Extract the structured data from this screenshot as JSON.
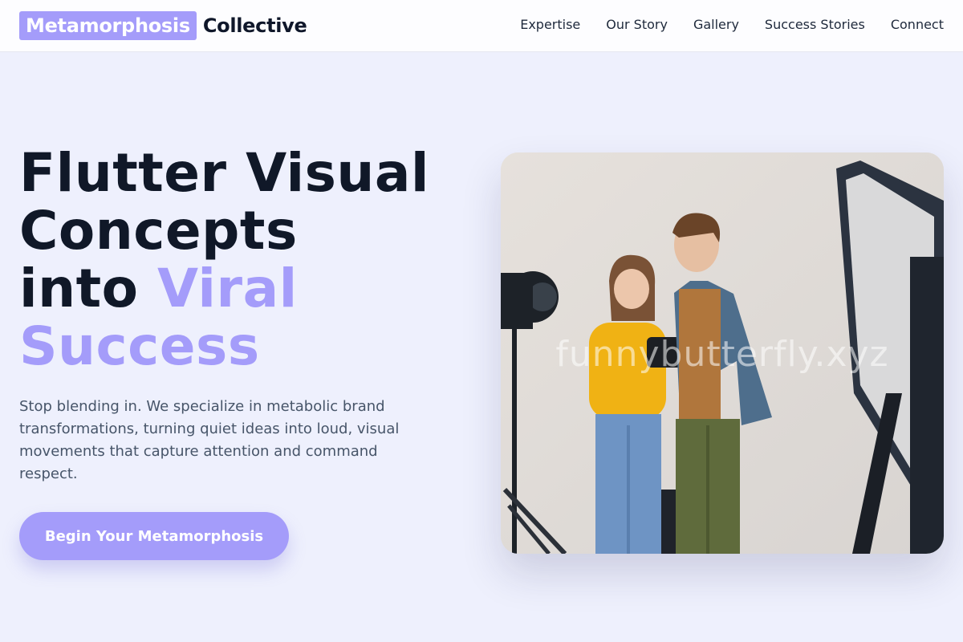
{
  "brand": {
    "highlight": "Metamorphosis",
    "rest": "Collective"
  },
  "nav": [
    {
      "label": "Expertise"
    },
    {
      "label": "Our Story"
    },
    {
      "label": "Gallery"
    },
    {
      "label": "Success Stories"
    },
    {
      "label": "Connect"
    }
  ],
  "hero": {
    "headline_line1": "Flutter Visual",
    "headline_line2": "Concepts",
    "headline_line3_plain": "into ",
    "headline_line3_accent": "Viral",
    "headline_line4_accent": "Success",
    "lede": "Stop blending in. We specialize in metabolic brand transformations, turning quiet ideas into loud, visual movements that capture attention and command respect.",
    "cta_label": "Begin Your Metamorphosis",
    "image_watermark": "funnybutterfly.xyz"
  },
  "colors": {
    "accent": "#a49cfa",
    "background": "#eef0fd",
    "heading": "#101828",
    "body_text": "#475569"
  }
}
